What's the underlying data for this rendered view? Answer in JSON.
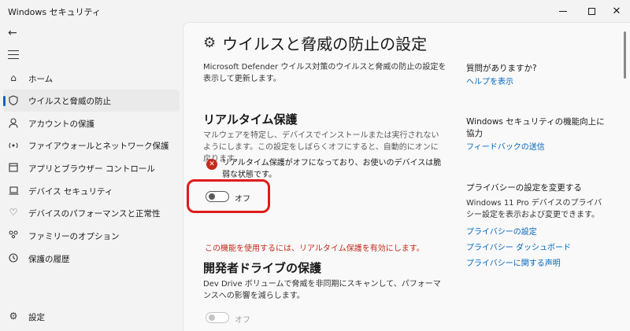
{
  "window": {
    "title": "Windows セキュリティ"
  },
  "sidebar": {
    "items": [
      {
        "label": "ホーム",
        "icon": "home-icon"
      },
      {
        "label": "ウイルスと脅威の防止",
        "icon": "shield-icon",
        "active": true
      },
      {
        "label": "アカウントの保護",
        "icon": "person-icon"
      },
      {
        "label": "ファイアウォールとネットワーク保護",
        "icon": "wifi-icon"
      },
      {
        "label": "アプリとブラウザー コントロール",
        "icon": "app-window-icon"
      },
      {
        "label": "デバイス セキュリティ",
        "icon": "laptop-icon"
      },
      {
        "label": "デバイスのパフォーマンスと正常性",
        "icon": "heart-icon"
      },
      {
        "label": "ファミリーのオプション",
        "icon": "family-icon"
      },
      {
        "label": "保護の履歴",
        "icon": "history-icon"
      }
    ],
    "settings_label": "設定"
  },
  "main": {
    "title": "ウイルスと脅威の防止の設定",
    "description": "Microsoft Defender ウイルス対策のウイルスと脅威の防止の設定を表示して更新します。",
    "realtime": {
      "title": "リアルタイム保護",
      "description": "マルウェアを特定し、デバイスでインストールまたは実行されないようにします。この設定をしばらくオフにすると、自動的にオンに戻ります。",
      "warning": "リアルタイム保護がオフになっており、お使いのデバイスは脆弱な状態です。",
      "toggle_label": "オフ",
      "toggle_on": false
    },
    "error_text": "この機能を使用するには、リアルタイム保護を有効にします。",
    "devdrive": {
      "title": "開発者ドライブの保護",
      "description": "Dev Drive ボリュームで脅威を非同期にスキャンして、パフォーマンスへの影響を減らします。",
      "toggle_label": "オフ",
      "toggle_on": false
    }
  },
  "right": {
    "question_heading": "質問がありますか?",
    "help_link": "ヘルプを表示",
    "improve_heading": "Windows セキュリティの機能向上に協力",
    "feedback_link": "フィードバックの送信",
    "privacy_heading": "プライバシーの設定を変更する",
    "privacy_text": "Windows 11 Pro デバイスのプライバシー設定を表示および変更できます。",
    "privacy_links": [
      "プライバシーの設定",
      "プライバシー ダッシュボード",
      "プライバシーに関する声明"
    ]
  },
  "colors": {
    "accent": "#0067c0",
    "error": "#c42b1c",
    "highlight": "#e01b1b"
  }
}
